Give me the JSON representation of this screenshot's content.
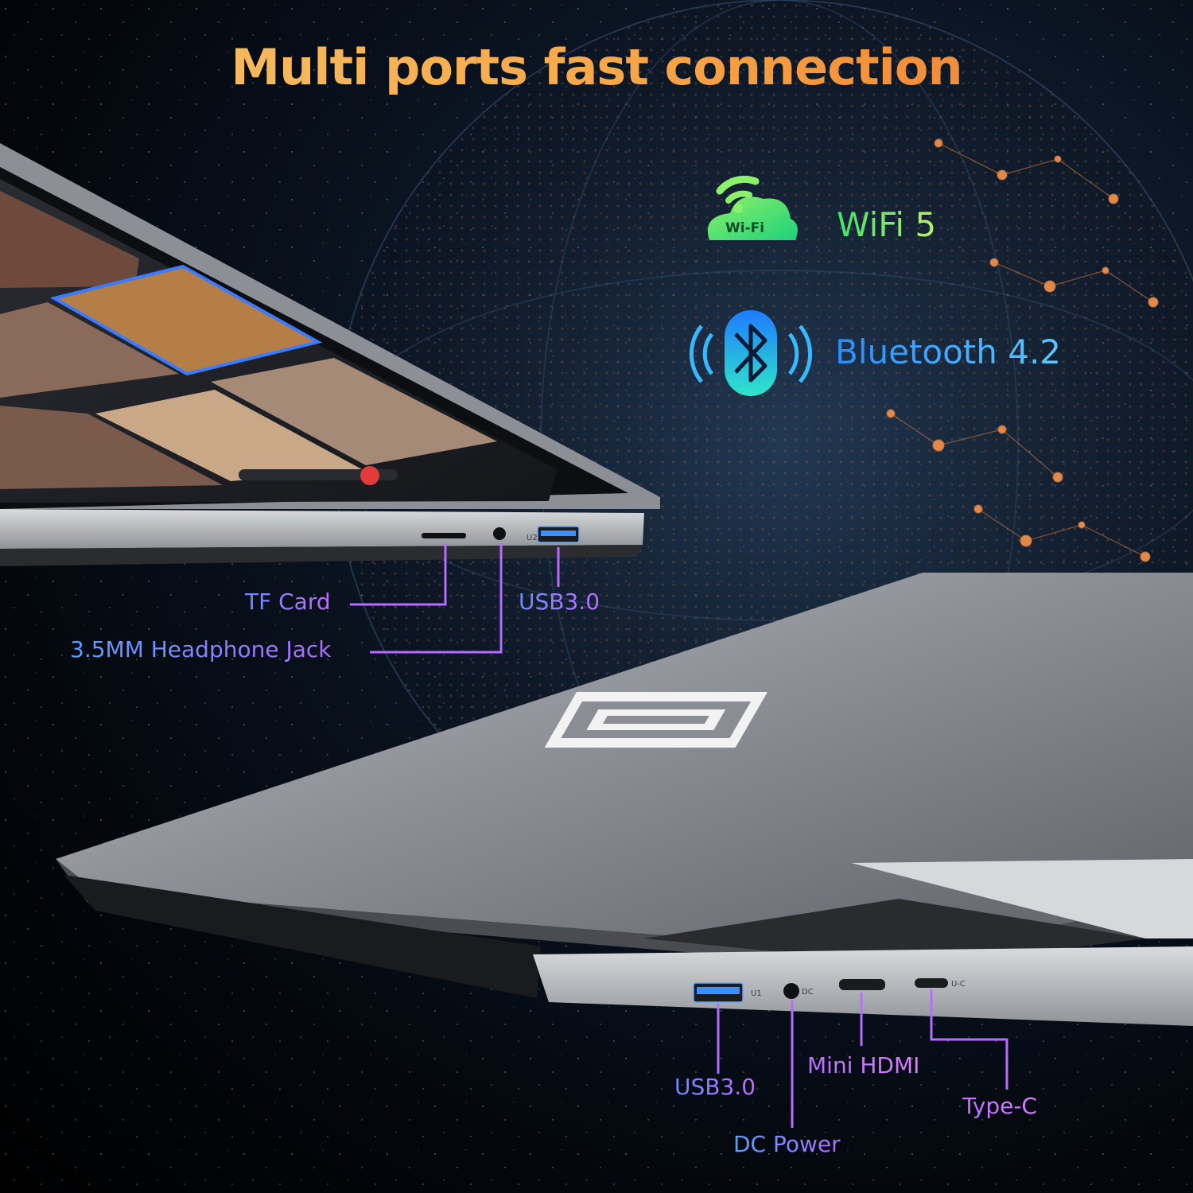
{
  "headline": "Multi ports fast connection",
  "features": {
    "wifi": {
      "badge": "Wi-Fi",
      "label": "WiFi 5",
      "icon": "wifi-cloud-icon"
    },
    "bluetooth": {
      "label": "Bluetooth 4.2",
      "icon": "bluetooth-icon"
    }
  },
  "ports_top": {
    "tf_card": "TF Card",
    "headphone": "3.5MM Headphone Jack",
    "usb": "USB3.0",
    "usb_marking": "U2"
  },
  "ports_bottom": {
    "usb": "USB3.0",
    "dc": "DC Power",
    "hdmi": "Mini HDMI",
    "typec": "Type-C",
    "usb_marking": "U1",
    "dc_marking": "DC",
    "typec_marking": "U-C"
  },
  "colors": {
    "headline": "#f6a94a",
    "wifi": "#3ee36a",
    "bluetooth": "#2a8cff",
    "port_lines": "#b86cff",
    "globe_dots": "#c8743a"
  }
}
